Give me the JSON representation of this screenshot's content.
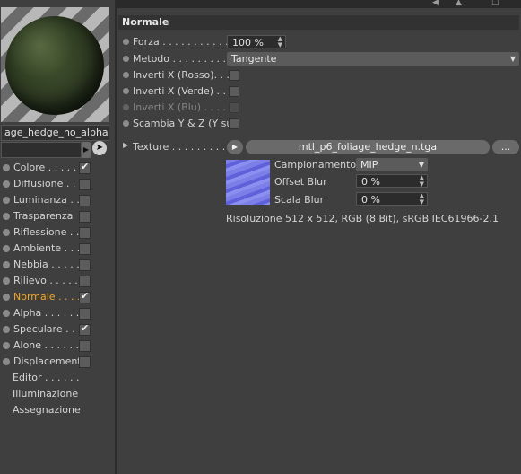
{
  "material": {
    "name": "age_hedge_no_alpha"
  },
  "channels": [
    {
      "label": "Colore . . . . .",
      "checked": true,
      "active": false
    },
    {
      "label": "Diffusione . .",
      "checked": false,
      "active": false
    },
    {
      "label": "Luminanza . .",
      "checked": false,
      "active": false
    },
    {
      "label": "Trasparenza",
      "checked": false,
      "active": false
    },
    {
      "label": "Riflessione . .",
      "checked": false,
      "active": false
    },
    {
      "label": "Ambiente . . .",
      "checked": false,
      "active": false
    },
    {
      "label": "Nebbia . . . . .",
      "checked": false,
      "active": false
    },
    {
      "label": "Rilievo . . . . .",
      "checked": false,
      "active": false
    },
    {
      "label": "Normale . . . .",
      "checked": true,
      "active": true
    },
    {
      "label": "Alpha . . . . . .",
      "checked": false,
      "active": false
    },
    {
      "label": "Speculare . . .",
      "checked": true,
      "active": false
    },
    {
      "label": "Alone . . . . . .",
      "checked": false,
      "active": false
    },
    {
      "label": "Displacement",
      "checked": false,
      "active": false
    }
  ],
  "extra_items": [
    "Editor . . . . . .",
    "Illuminazione",
    "Assegnazione"
  ],
  "panel": {
    "title": "Normale",
    "forza_label": "Forza . . . . . . . . . . .",
    "forza_value": "100 %",
    "metodo_label": "Metodo . . . . . . . . .",
    "metodo_value": "Tangente",
    "inverti_rosso_label": "Inverti X (Rosso). . .",
    "inverti_verde_label": "Inverti X (Verde) . .",
    "inverti_blu_label": "Inverti X (Blu) . . . . .",
    "scambia_label": "Scambia Y & Z (Y su)",
    "texture_label": "Texture . . . . . . . . . .",
    "texture_file": "mtl_p6_foliage_hedge_n.tga",
    "browse_label": "...",
    "campionamento_label": "Campionamento",
    "campionamento_value": "MIP",
    "offset_blur_label": "Offset Blur",
    "offset_blur_value": "0 %",
    "scala_blur_label": "Scala Blur",
    "scala_blur_value": "0 %",
    "resolution_text": "Risoluzione 512 x 512, RGB (8 Bit), sRGB IEC61966-2.1"
  }
}
